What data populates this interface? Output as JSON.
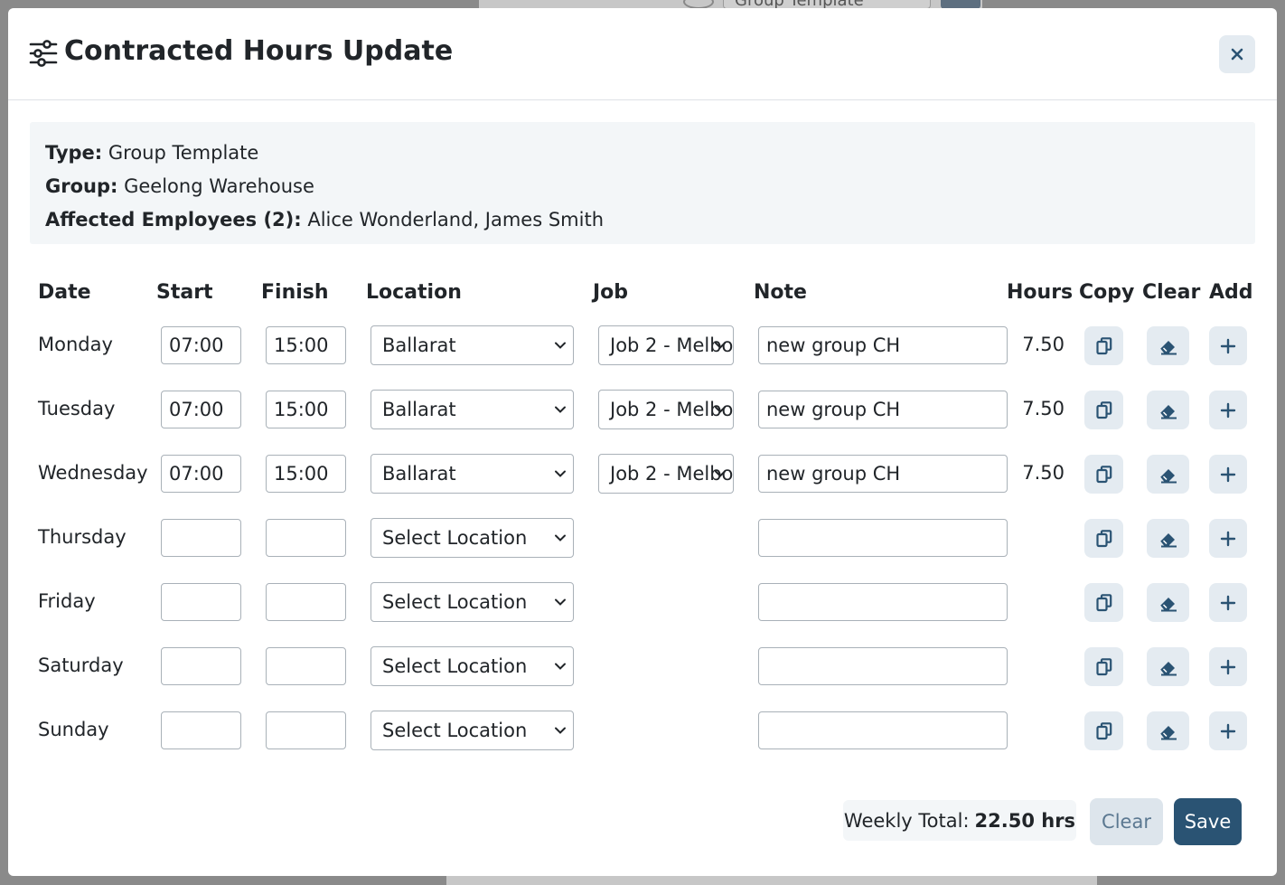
{
  "background": {
    "select_value": "Group Template"
  },
  "modal": {
    "title": "Contracted Hours Update",
    "close_symbol": "×",
    "header_icon": "sliders-icon"
  },
  "info": {
    "type_label": "Type:",
    "type_value": "Group Template",
    "group_label": "Group:",
    "group_value": "Geelong Warehouse",
    "employees_label": "Affected Employees (2):",
    "employees_value": "Alice Wonderland, James Smith"
  },
  "table": {
    "headers": {
      "date": "Date",
      "start": "Start",
      "finish": "Finish",
      "location": "Location",
      "job": "Job",
      "note": "Note",
      "hours": "Hours",
      "copy": "Copy",
      "clear": "Clear",
      "add": "Add"
    },
    "rows": [
      {
        "day": "Monday",
        "start": "07:00",
        "finish": "15:00",
        "location": "Ballarat",
        "job": "Job 2 - Melbo",
        "note": "new group CH",
        "hours": "7.50"
      },
      {
        "day": "Tuesday",
        "start": "07:00",
        "finish": "15:00",
        "location": "Ballarat",
        "job": "Job 2 - Melbo",
        "note": "new group CH",
        "hours": "7.50"
      },
      {
        "day": "Wednesday",
        "start": "07:00",
        "finish": "15:00",
        "location": "Ballarat",
        "job": "Job 2 - Melbo",
        "note": "new group CH",
        "hours": "7.50"
      },
      {
        "day": "Thursday",
        "start": "",
        "finish": "",
        "location": "Select Location",
        "job": "",
        "note": "",
        "hours": ""
      },
      {
        "day": "Friday",
        "start": "",
        "finish": "",
        "location": "Select Location",
        "job": "",
        "note": "",
        "hours": ""
      },
      {
        "day": "Saturday",
        "start": "",
        "finish": "",
        "location": "Select Location",
        "job": "",
        "note": "",
        "hours": ""
      },
      {
        "day": "Sunday",
        "start": "",
        "finish": "",
        "location": "Select Location",
        "job": "",
        "note": "",
        "hours": ""
      }
    ]
  },
  "footer": {
    "total_label": "Weekly Total:",
    "total_value": "22.50 hrs",
    "clear_label": "Clear",
    "save_label": "Save"
  },
  "colors": {
    "accent": "#2a5373",
    "icon_button_bg": "#e4ebf1",
    "info_bg": "#f3f6f8"
  }
}
